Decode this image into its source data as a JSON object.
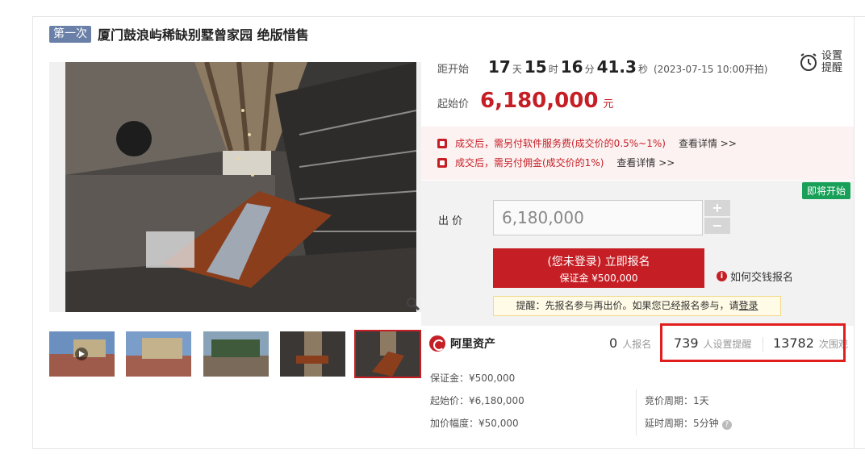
{
  "header": {
    "round_badge": "第一次",
    "title": "厦门鼓浪屿稀缺别墅曾家园 绝版惜售"
  },
  "countdown": {
    "label": "距开始",
    "days": "17",
    "days_unit": "天",
    "hours": "15",
    "hours_unit": "时",
    "minutes": "16",
    "minutes_unit": "分",
    "seconds": "41.3",
    "seconds_unit": "秒",
    "start_note": "(2023-07-15 10:00开拍)"
  },
  "reminder": {
    "label": "设置提醒"
  },
  "start_price": {
    "label": "起始价",
    "value": "6,180,000",
    "unit": "元"
  },
  "fees": [
    {
      "text": "成交后，需另付软件服务费(成交价的0.5%~1%)",
      "link": "查看详情 >>"
    },
    {
      "text": "成交后，需另付佣金(成交价的1%)",
      "link": "查看详情 >>"
    }
  ],
  "bid": {
    "status_tag": "即将开始",
    "label": "出 价",
    "input_value": "6,180,000",
    "plus": "+",
    "minus": "−",
    "signup_line1": "(您未登录) 立即报名",
    "signup_line2": "保证金 ¥500,000",
    "howto": "如何交钱报名",
    "tip": "提醒：先报名参与再出价。如果您已经报名参与，请",
    "tip_login": "登录"
  },
  "stats": {
    "brand": "阿里资产",
    "signups": "0",
    "signups_label": "人报名",
    "reminders": "739",
    "reminders_label": "人设置提醒",
    "views": "13782",
    "views_label": "次围观"
  },
  "details": {
    "deposit": "保证金：¥500,000",
    "start_price": "起始价：¥6,180,000",
    "increment": "加价幅度：¥50,000",
    "period": "竞价周期：1天",
    "extension": "延时周期：5分钟"
  },
  "icons": {
    "zoom": "magnifier-icon",
    "clock": "alarm-clock-icon",
    "info": "info-icon",
    "help": "question-icon",
    "play": "play-icon"
  },
  "colors": {
    "accent": "#c51f25",
    "badge": "#6a80a8",
    "status": "#18a058"
  }
}
